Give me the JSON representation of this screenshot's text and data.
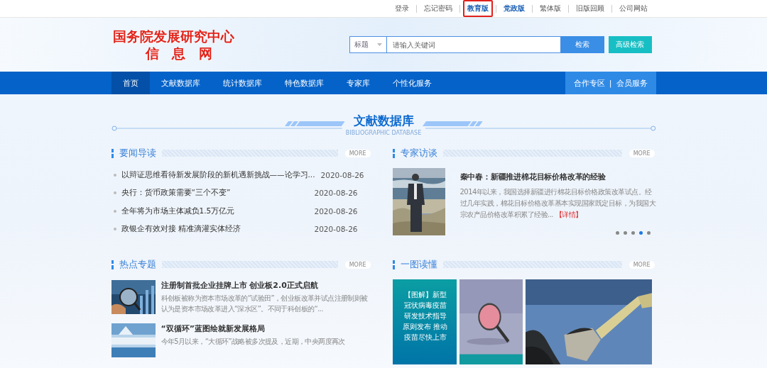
{
  "top_links": [
    {
      "label": "登录",
      "kind": "plain",
      "outlined": false
    },
    {
      "label": "忘记密码",
      "kind": "plain",
      "outlined": false
    },
    {
      "label": "教育版",
      "kind": "bold",
      "outlined": true
    },
    {
      "label": "党政版",
      "kind": "bold",
      "outlined": false
    },
    {
      "label": "繁体版",
      "kind": "plain",
      "outlined": false
    },
    {
      "label": "旧版回顾",
      "kind": "plain",
      "outlined": false
    },
    {
      "label": "公司网站",
      "kind": "plain",
      "outlined": false
    }
  ],
  "logo": {
    "line1": "国务院发展研究中心",
    "line2": "信 息 网"
  },
  "search": {
    "scope": "标题",
    "placeholder": "请输入关键词",
    "button": "检索",
    "advanced": "高级检索"
  },
  "nav": {
    "items": [
      {
        "label": "首页",
        "selected": true
      },
      {
        "label": "文献数据库",
        "selected": false
      },
      {
        "label": "统计数据库",
        "selected": false
      },
      {
        "label": "特色数据库",
        "selected": false
      },
      {
        "label": "专家库",
        "selected": false
      },
      {
        "label": "个性化服务",
        "selected": false
      }
    ],
    "right": [
      "合作专区",
      "会员服务"
    ],
    "separator": "|"
  },
  "section": {
    "title": "文献数据库",
    "subtitle": "BIBLIOGRAPHIC DATABASE"
  },
  "news": {
    "title": "要闻导读",
    "more": "MORE",
    "items": [
      {
        "title": "以辩证思维看待新发展阶段的新机遇新挑战——论学习...",
        "date": "2020-08-26"
      },
      {
        "title": "央行：货币政策需要“三个不变”",
        "date": "2020-08-26"
      },
      {
        "title": "全年将为市场主体减负1.5万亿元",
        "date": "2020-08-26"
      },
      {
        "title": "政银企有效对接 精准滴灌实体经济",
        "date": "2020-08-26"
      }
    ]
  },
  "interview": {
    "title": "专家访谈",
    "more": "MORE",
    "headline": "秦中春：新疆推进棉花目标价格改革的经验",
    "summary": "2014年以来，我国选择新疆进行棉花目标价格政策改革试点。经过几年实践，棉花目标价格改革基本实现国家既定目标，为我国大宗农产品价格改革积累了经验...",
    "detail": "【详情】",
    "dots": [
      {
        "selected": false
      },
      {
        "selected": false
      },
      {
        "selected": false
      },
      {
        "selected": true
      },
      {
        "selected": false
      }
    ]
  },
  "topics": {
    "title": "热点专题",
    "more": "MORE",
    "items": [
      {
        "title": "注册制首批企业挂牌上市 创业板2.0正式启航",
        "summary": "科创板被称为资本市场改革的“试验田”，创业板改革并试点注册制则被认为是资本市场改革进入“深水区”。不同于科创板的“..."
      },
      {
        "title": "“双循环”蓝图绘就新发展格局",
        "summary": "今年5月以来，“大循环”战略被多次提及，近期，中央两度再次"
      }
    ]
  },
  "infographics": {
    "title": "一图读懂",
    "more": "MORE",
    "caption": "【图解】新型冠状病毒疫苗研发技术指导原则发布 推动疫苗尽快上市"
  }
}
